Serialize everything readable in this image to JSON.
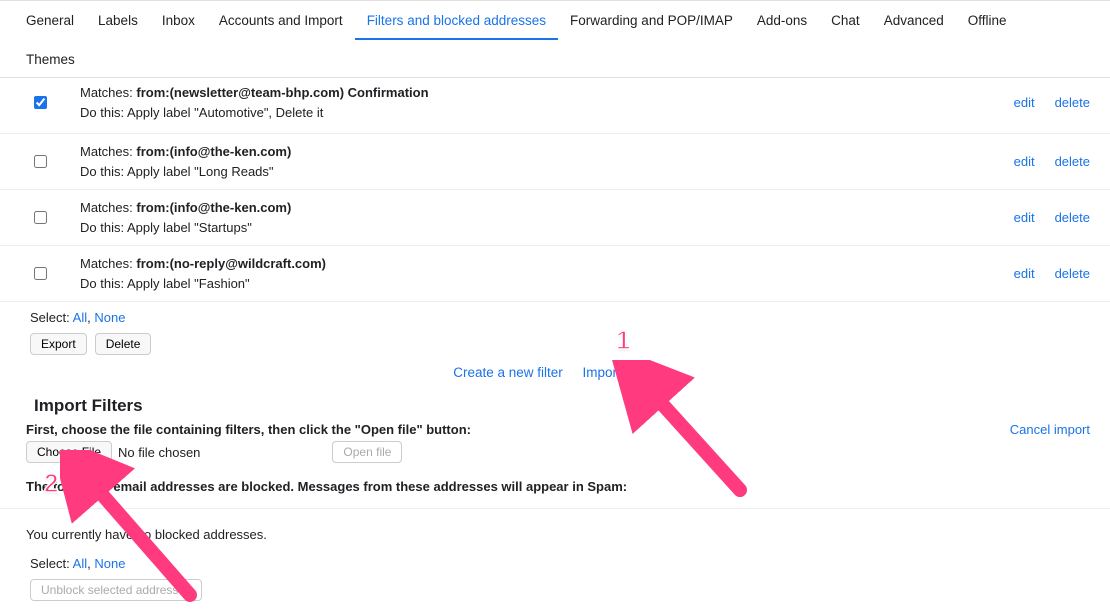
{
  "tabs": {
    "row1": [
      "General",
      "Labels",
      "Inbox",
      "Accounts and Import",
      "Filters and blocked addresses",
      "Forwarding and POP/IMAP",
      "Add-ons",
      "Chat",
      "Advanced",
      "Offline"
    ],
    "row2": [
      "Themes"
    ],
    "active": "Filters and blocked addresses"
  },
  "filters": [
    {
      "checked": true,
      "matches_label": "Matches: ",
      "matches_value": "from:(newsletter@team-bhp.com) Confirmation",
      "action": "Do this: Apply label \"Automotive\", Delete it",
      "edit": "edit",
      "del": "delete"
    },
    {
      "checked": false,
      "matches_label": "Matches: ",
      "matches_value": "from:(info@the-ken.com)",
      "action": "Do this: Apply label \"Long Reads\"",
      "edit": "edit",
      "del": "delete"
    },
    {
      "checked": false,
      "matches_label": "Matches: ",
      "matches_value": "from:(info@the-ken.com)",
      "action": "Do this: Apply label \"Startups\"",
      "edit": "edit",
      "del": "delete"
    },
    {
      "checked": false,
      "matches_label": "Matches: ",
      "matches_value": "from:(no-reply@wildcraft.com)",
      "action": "Do this: Apply label \"Fashion\"",
      "edit": "edit",
      "del": "delete"
    }
  ],
  "select": {
    "label": "Select:",
    "all": "All",
    "comma": ", ",
    "none": "None"
  },
  "buttons": {
    "export": "Export",
    "delete": "Delete"
  },
  "center": {
    "create": "Create a new filter",
    "import": "Import filters"
  },
  "importSection": {
    "heading": "Import Filters",
    "instruction": "First, choose the file containing filters, then click the \"Open file\" button:",
    "chooseFile": "Choose File",
    "noFile": "No file chosen",
    "openFile": "Open file",
    "cancel": "Cancel import"
  },
  "blocked": {
    "heading": "The following email addresses are blocked. Messages from these addresses will appear in Spam:",
    "empty": "You currently have no blocked addresses.",
    "select": {
      "label": "Select:",
      "all": "All",
      "comma": ", ",
      "none": "None"
    },
    "unblock": "Unblock selected addresses"
  },
  "anno": {
    "one": "1",
    "two": "2"
  }
}
